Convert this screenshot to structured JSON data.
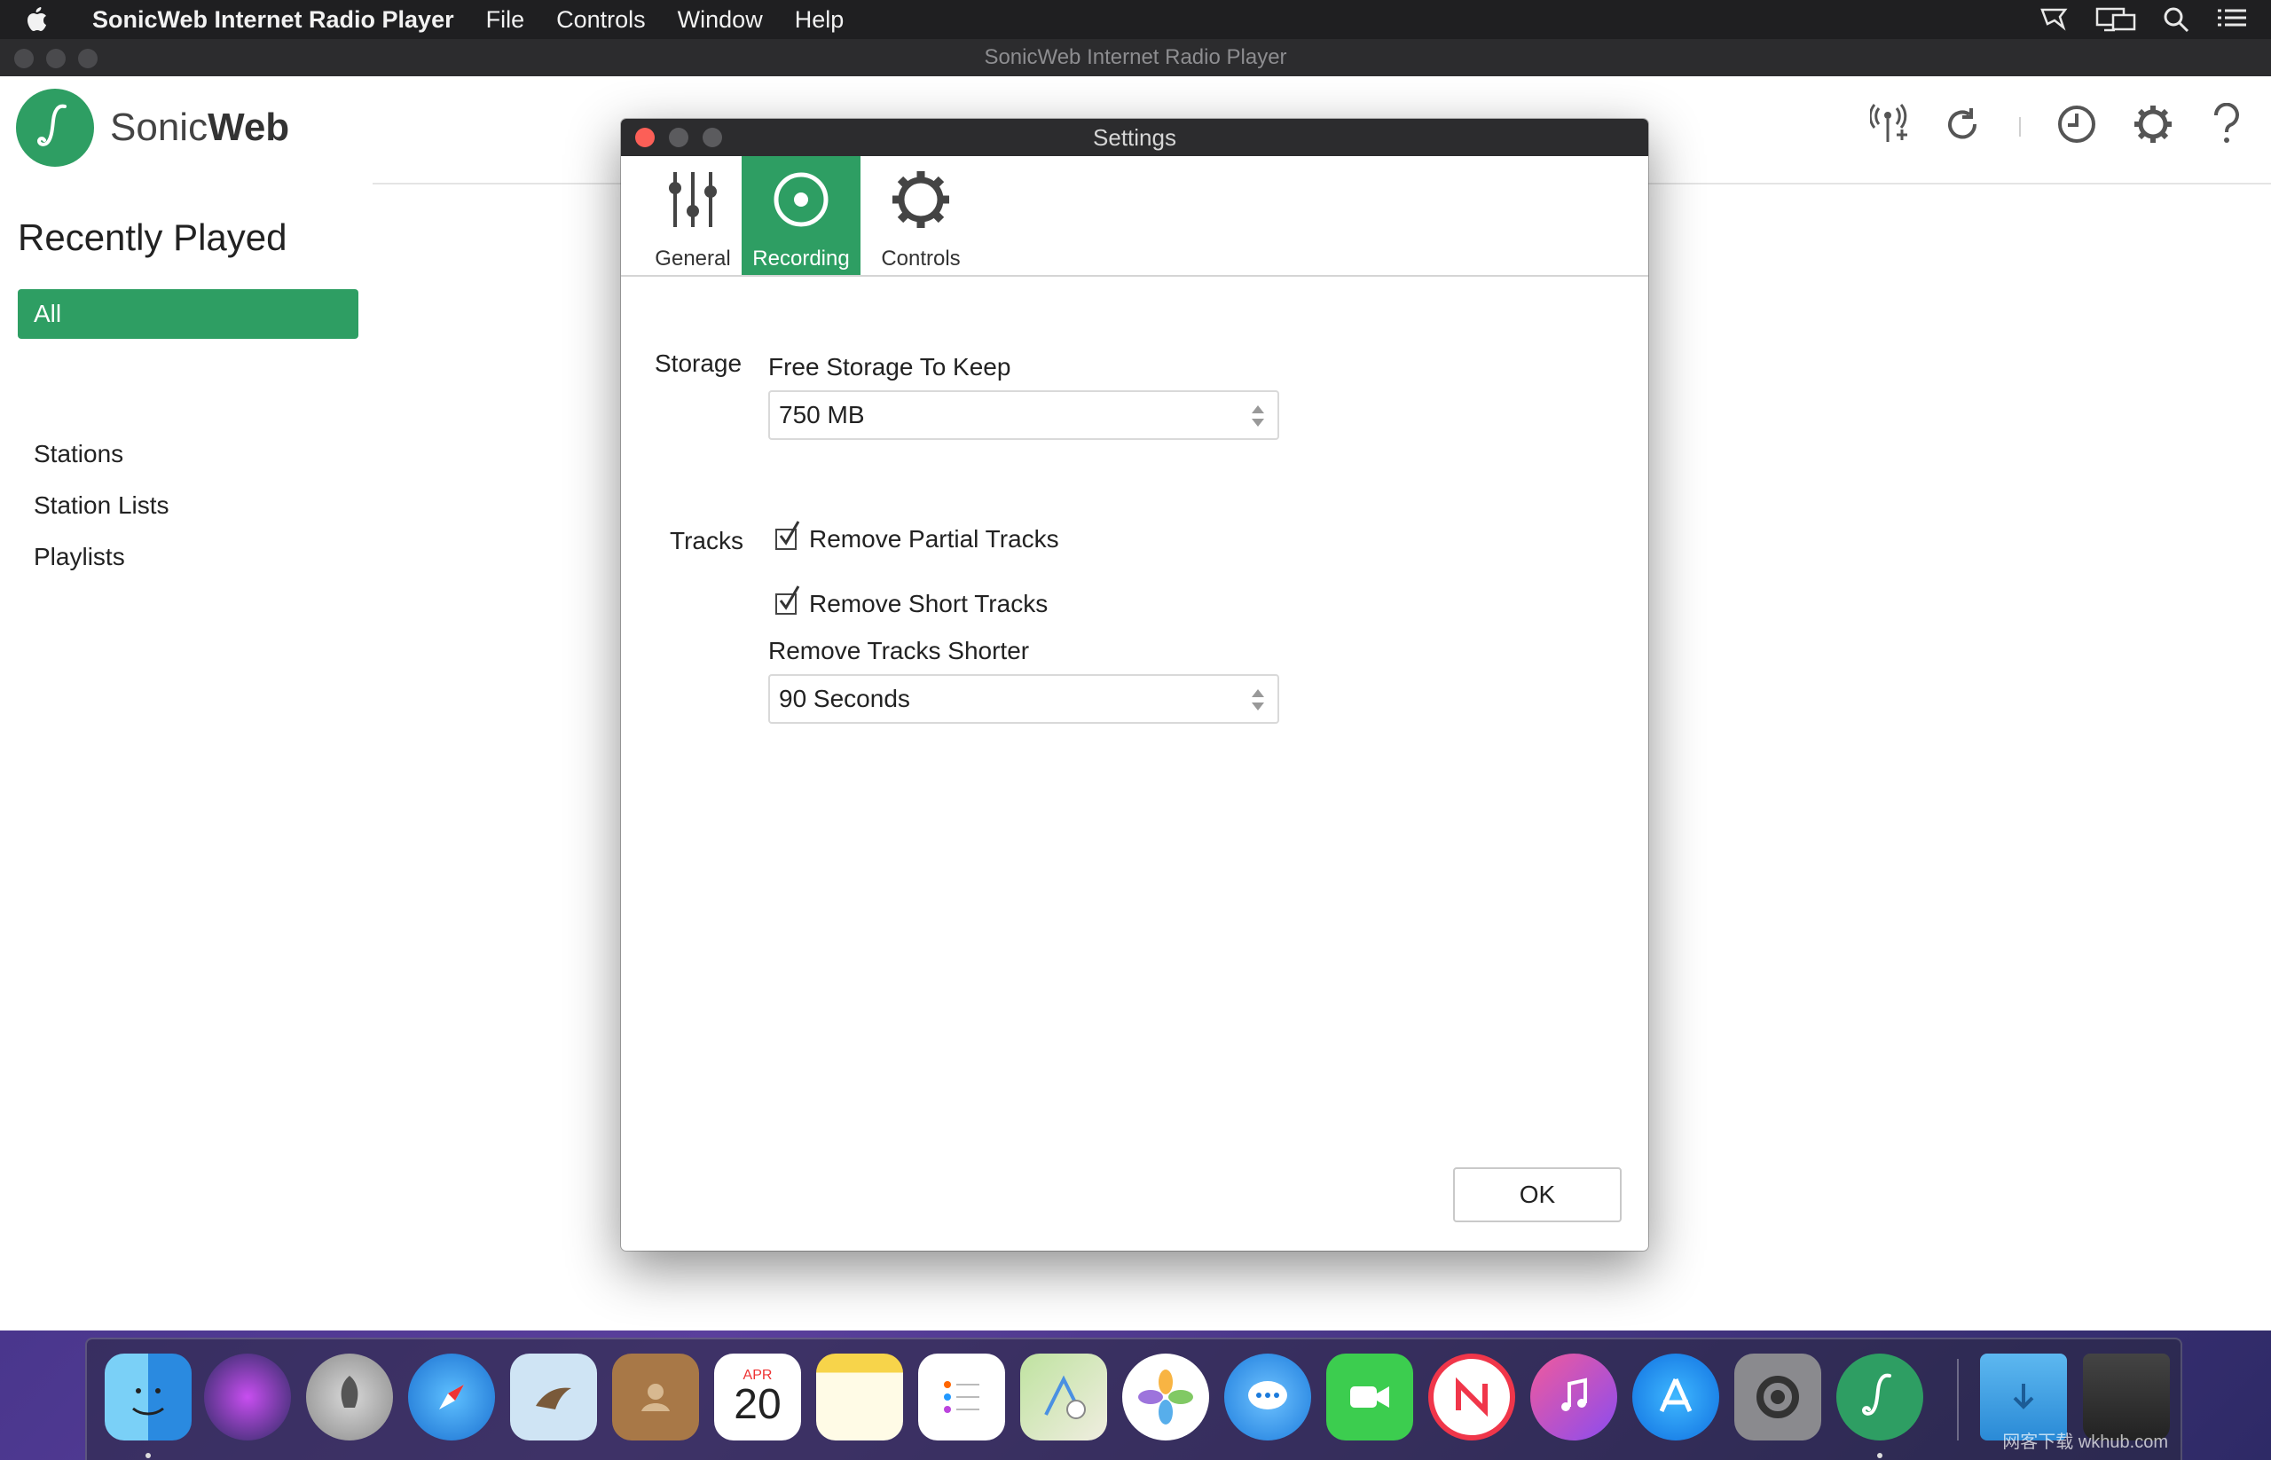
{
  "menubar": {
    "app_name": "SonicWeb Internet Radio Player",
    "menus": [
      "File",
      "Controls",
      "Window",
      "Help"
    ],
    "status_icons": [
      "airplay-icon",
      "display-icon",
      "search-icon",
      "list-icon"
    ]
  },
  "window": {
    "title": "SonicWeb Internet Radio Player",
    "logo": {
      "part1": "Sonic",
      "part2": "Web"
    },
    "toolbar_icons": [
      "add-station-icon",
      "refresh-icon",
      "history-icon",
      "settings-icon",
      "help-icon"
    ]
  },
  "sidebar": {
    "heading": "Recently Played",
    "filter_label": "All",
    "links": [
      "Stations",
      "Station Lists",
      "Playlists"
    ]
  },
  "settings": {
    "title": "Settings",
    "tabs": [
      {
        "label": "General",
        "icon": "sliders-icon",
        "active": false
      },
      {
        "label": "Recording",
        "icon": "record-icon",
        "active": true
      },
      {
        "label": "Controls",
        "icon": "gear-icon",
        "active": false
      }
    ],
    "storage": {
      "section_label": "Storage",
      "field_label": "Free Storage To Keep",
      "value": "750 MB"
    },
    "tracks": {
      "section_label": "Tracks",
      "remove_partial_label": "Remove Partial Tracks",
      "remove_partial_checked": true,
      "remove_short_label": "Remove Short Tracks",
      "remove_short_checked": true,
      "shorter_label": "Remove Tracks Shorter",
      "shorter_value": "90 Seconds"
    },
    "ok_label": "OK"
  },
  "dock": {
    "apps": [
      "Finder",
      "Siri",
      "Launchpad",
      "Safari",
      "Mail",
      "Contacts",
      "Calendar",
      "Notes",
      "Reminders",
      "Maps",
      "Photos",
      "Messages",
      "FaceTime",
      "News",
      "iTunes",
      "App Store",
      "System Preferences",
      "SonicWeb",
      "Downloads",
      "Trash"
    ],
    "calendar_month": "APR",
    "calendar_day": "20"
  },
  "watermark": "网客下载 wkhub.com"
}
